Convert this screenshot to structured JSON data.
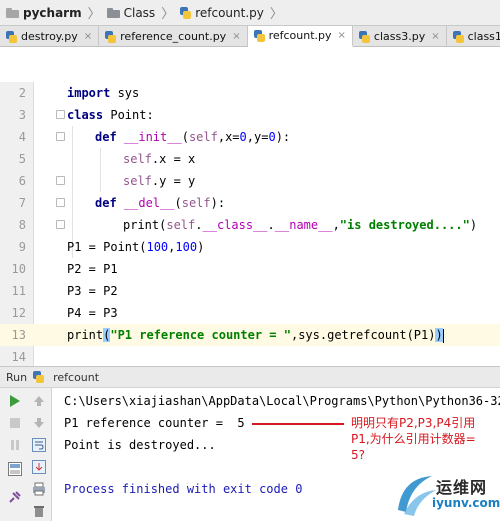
{
  "breadcrumb": {
    "project": "pycharm",
    "folder": "Class",
    "file": "refcount.py"
  },
  "tabs": [
    {
      "label": "destroy.py",
      "active": false
    },
    {
      "label": "reference_count.py",
      "active": false
    },
    {
      "label": "refcount.py",
      "active": true
    },
    {
      "label": "class3.py",
      "active": false
    },
    {
      "label": "class1.py",
      "active": false
    }
  ],
  "tab_close_glyph": "×",
  "editor": {
    "line_numbers": [
      "2",
      "3",
      "4",
      "5",
      "6",
      "7",
      "8",
      "9",
      "10",
      "11",
      "12",
      "13",
      "14"
    ],
    "current_line": "13",
    "lines": {
      "l2_kw": "import",
      "l2_rest": " sys",
      "l3_kw": "class",
      "l3_rest": " Point:",
      "l4_kw": "def",
      "l4_name": " __init__",
      "l4_self": "self",
      "l4_args": ",x=",
      "l4_n1": "0",
      "l4_args2": ",y=",
      "l4_n2": "0",
      "l4_end": "):",
      "l5_self": "self",
      "l5_rest": ".x = x",
      "l6_self": "self",
      "l6_rest": ".y = y",
      "l7_kw": "def",
      "l7_name": " __del__",
      "l7_self": "self",
      "l7_end": "):",
      "l8_fn": "print",
      "l8_self": "self",
      "l8_class": "__class__",
      "l8_name": "__name__",
      "l8_str": "\"is destroyed....\"",
      "l9_rest": "P1 = Point(",
      "l9_n1": "100",
      "l9_n2": "100",
      "l10": "P2 = P1",
      "l11": "P3 = P2",
      "l12": "P4 = P3",
      "l13_fn": "print",
      "l13_str": "\"P1 reference counter = \"",
      "l13_rest": ",sys.getrefcount(P1)"
    }
  },
  "run": {
    "label": "Run",
    "config": "refcount",
    "output": [
      "C:\\Users\\xiajiashan\\AppData\\Local\\Programs\\Python\\Python36-32",
      "P1 reference counter =  5",
      "Point is destroyed...",
      "",
      "Process finished with exit code 0"
    ]
  },
  "annotation": {
    "line1": "明明只有P2,P3,P4引用",
    "line2": "P1,为什么引用计数器=",
    "line3": "5?"
  },
  "watermark": {
    "title": "运维网",
    "url": "iyunv.com"
  },
  "colors": {
    "keyword": "#000080",
    "self": "#94558d",
    "number": "#0000ff",
    "string": "#008000",
    "annotation": "#d6171f",
    "current_line_bg": "#fffae3"
  }
}
